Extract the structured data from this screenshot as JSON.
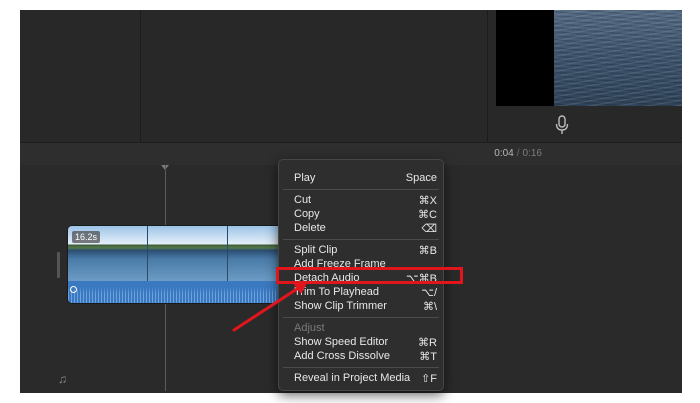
{
  "viewer": {
    "mic_icon": "microphone-icon"
  },
  "timecode": {
    "current": "0:04",
    "separator": "/",
    "duration": "0:16"
  },
  "clip": {
    "duration_label": "16.2s"
  },
  "timeline": {
    "music_icon": "music-note-icon"
  },
  "context_menu": {
    "items": [
      {
        "label": "Play",
        "shortcut": "Space"
      },
      {
        "label": "Cut",
        "shortcut": "⌘X"
      },
      {
        "label": "Copy",
        "shortcut": "⌘C"
      },
      {
        "label": "Delete",
        "shortcut": "⌫"
      },
      {
        "label": "Split Clip",
        "shortcut": "⌘B"
      },
      {
        "label": "Add Freeze Frame",
        "shortcut": ""
      },
      {
        "label": "Detach Audio",
        "shortcut": "⌥⌘B"
      },
      {
        "label": "Trim To Playhead",
        "shortcut": "⌥/"
      },
      {
        "label": "Show Clip Trimmer",
        "shortcut": "⌘\\"
      },
      {
        "label": "Adjust",
        "shortcut": ""
      },
      {
        "label": "Show Speed Editor",
        "shortcut": "⌘R"
      },
      {
        "label": "Add Cross Dissolve",
        "shortcut": "⌘T"
      },
      {
        "label": "Reveal in Project Media",
        "shortcut": "⇧F"
      }
    ]
  },
  "annotation": {
    "highlight_color": "#e0161c"
  }
}
